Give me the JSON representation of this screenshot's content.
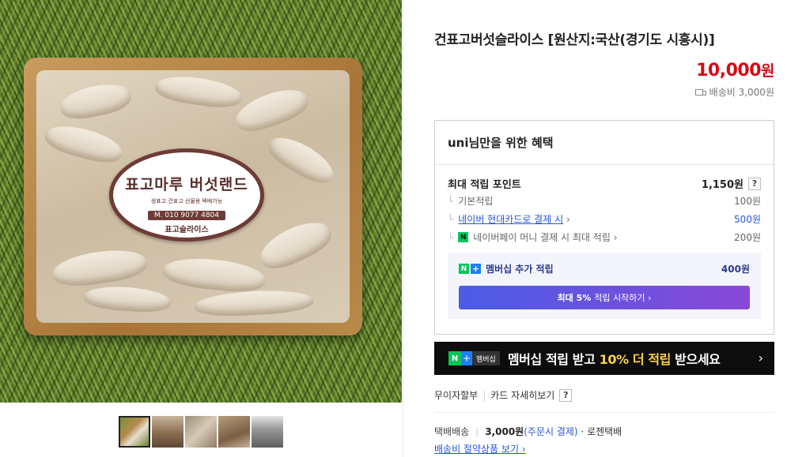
{
  "product": {
    "title": "건표고버섯슬라이스 [원산지:국산(경기도 시흥시)]",
    "price_amount": "10,000",
    "price_unit": "원",
    "shipping_fee_text": "배송비 3,000원"
  },
  "image_label": {
    "brand": "표고마루 버섯랜드",
    "tagline": "생표고 건표고 선물용 택배가능",
    "phone": "M. 010 9077 4804",
    "product_name": "표고슬라이스"
  },
  "benefit": {
    "title": "uni님만을 위한 혜택",
    "max_points_label": "최대 적립 포인트",
    "max_points_value": "1,150원",
    "help_icon": "?",
    "rows": [
      {
        "label": "기본적립",
        "value": "100원"
      },
      {
        "label": "네이버 현대카드로 결제 시",
        "value": "500원"
      },
      {
        "label": "네이버페이 머니 결제 시 최대 적립",
        "value": "200원"
      }
    ],
    "member_label": "멤버십 추가 적립",
    "member_value": "400원",
    "member_button_bold": "최대 5%",
    "member_button_text": "적립 시작하기",
    "chevron": "›"
  },
  "banner": {
    "badge_text": "멤버십",
    "msg_pre": "멤버십 적립 받고 ",
    "msg_highlight": "10% 더 적립",
    "msg_post": " 받으세요",
    "chevron": "›"
  },
  "payment": {
    "installment": "무이자할부",
    "card_detail": "카드 자세히보기",
    "help_icon": "?"
  },
  "delivery": {
    "method": "택배배송",
    "fee": "3,000원",
    "condition": "(주문시 결제)",
    "courier": "· 로젠택배",
    "save_link": "배송비 절약상품 보기"
  },
  "icons": {
    "n_mark": "N",
    "plus_mark": "+"
  },
  "colors": {
    "price": "#d70a16",
    "link": "#2756d6",
    "naver_green": "#03c75a",
    "banner_bg": "#0d0d0d",
    "banner_highlight": "#f8d24a"
  }
}
